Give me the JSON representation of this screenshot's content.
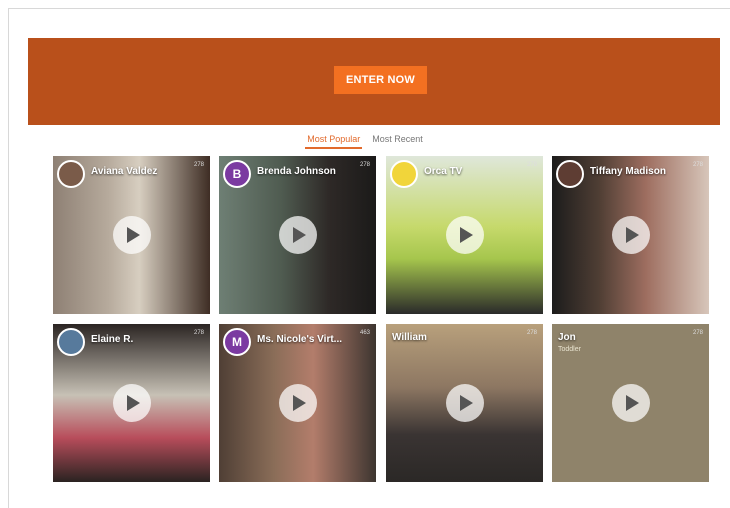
{
  "banner": {
    "cta_label": "ENTER NOW"
  },
  "tabs": [
    {
      "label": "Most Popular",
      "active": true
    },
    {
      "label": "Most Recent",
      "active": false
    }
  ],
  "videos": [
    {
      "name": "Aviana Valdez",
      "avatar_letter": "",
      "avatar_color": "#7a5b49",
      "thumb_color": "#6f5f4f",
      "stat": "278"
    },
    {
      "name": "Brenda Johnson",
      "avatar_letter": "B",
      "avatar_color": "#7b3aa1",
      "thumb_color": "#3f493b",
      "stat": "278"
    },
    {
      "name": "Orca TV",
      "avatar_letter": "",
      "avatar_color": "#f1d53a",
      "thumb_color": "#b8c56d",
      "stat": "278"
    },
    {
      "name": "Tiffany Madison",
      "avatar_letter": "",
      "avatar_color": "#5e3d33",
      "thumb_color": "#6d4a44",
      "stat": "278"
    },
    {
      "name": "Elaine R.",
      "avatar_letter": "",
      "avatar_color": "#577a9c",
      "thumb_color": "#5f524f",
      "stat": "278"
    },
    {
      "name": "Ms. Nicole's Virt...",
      "avatar_letter": "M",
      "avatar_color": "#7b3aa1",
      "thumb_color": "#6a5548",
      "stat": "463"
    },
    {
      "name": "William",
      "avatar_letter": "",
      "avatar_color": "",
      "thumb_color": "#7a675a",
      "stat": "278"
    },
    {
      "name": "Jon",
      "avatar_letter": "",
      "avatar_color": "",
      "thumb_color": "#8f836a",
      "stat": "278",
      "subtitle": "Toddler"
    }
  ]
}
